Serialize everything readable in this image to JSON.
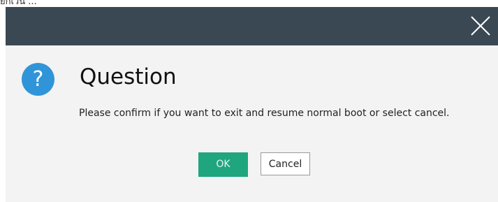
{
  "page_fragment": "ยกเว้น ...",
  "dialog": {
    "close_icon": "close-icon",
    "icon": "question-icon",
    "icon_glyph": "?",
    "icon_color": "#2f95d8",
    "title": "Question",
    "message": "Please confirm if you want to exit and resume normal boot or select cancel.",
    "buttons": {
      "ok_label": "OK",
      "cancel_label": "Cancel"
    }
  },
  "colors": {
    "titlebar": "#3a4853",
    "dialog_bg": "#f3f3f3",
    "ok_button": "#1fa67f"
  }
}
